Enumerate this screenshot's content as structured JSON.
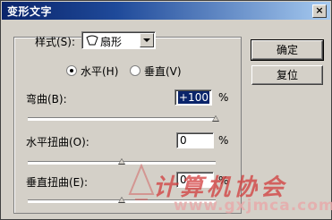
{
  "window": {
    "title": "变形文字",
    "close_glyph": "×"
  },
  "style": {
    "label": "样式(S):",
    "value": "扇形",
    "icon": "fan-shape-icon"
  },
  "orientation": {
    "horizontal_label": "水平(H)",
    "vertical_label": "垂直(V)",
    "selected": "horizontal"
  },
  "bend": {
    "label": "弯曲(B):",
    "value": "+100",
    "unit": "%",
    "slider_value": 100
  },
  "horizontal_distortion": {
    "label": "水平扭曲(O):",
    "value": "0",
    "unit": "%",
    "slider_value": 0
  },
  "vertical_distortion": {
    "label": "垂直扭曲(E):",
    "value": "0",
    "unit": "%",
    "slider_value": 0
  },
  "buttons": {
    "ok": "确定",
    "reset": "复位"
  },
  "watermark": {
    "text": "计算机协会",
    "url": "www.gxjmca.com"
  },
  "colors": {
    "title_start": "#0a246a",
    "title_end": "#a6caf0",
    "dialog_bg": "#d4d0c8"
  }
}
